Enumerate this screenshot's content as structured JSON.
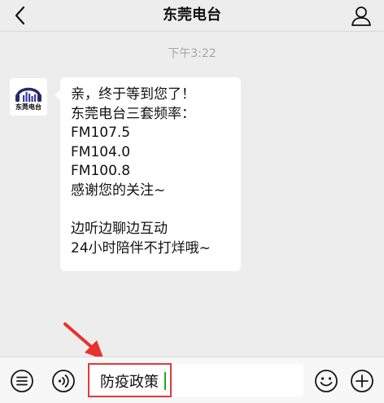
{
  "header": {
    "title": "东莞电台",
    "back_icon": "chevron-left-icon",
    "profile_icon": "person-icon"
  },
  "chat": {
    "timestamp": "下午3:22",
    "avatar": {
      "label": "东莞电台",
      "icon": "headphones-logo"
    },
    "message": {
      "lines": [
        "亲，终于等到您了！",
        "东莞电台三套频率：",
        "FM107.5",
        "FM104.0",
        "FM100.8",
        "感谢您的关注~",
        "",
        "边听边聊边互动",
        "24小时陪伴不打烊哦~"
      ]
    }
  },
  "toolbar": {
    "menu_icon": "list-menu-icon",
    "voice_icon": "voice-icon",
    "input_value": "防疫政策",
    "emoji_icon": "emoji-icon",
    "plus_icon": "plus-icon"
  },
  "colors": {
    "background": "#ededed",
    "bubble": "#ffffff",
    "highlight": "#e03a3a",
    "cursor": "#1aad19"
  }
}
